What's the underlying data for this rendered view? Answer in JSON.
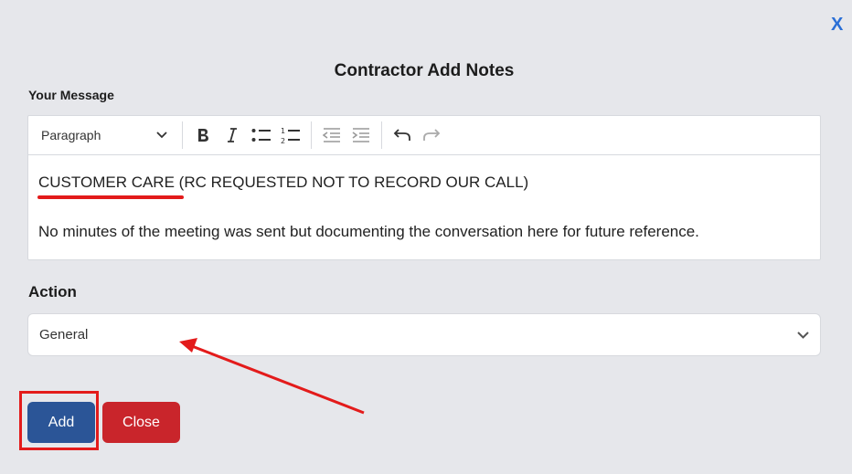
{
  "dialog": {
    "close_glyph": "X",
    "title": "Contractor Add Notes",
    "message_label": "Your Message"
  },
  "editor": {
    "toolbar": {
      "paragraph_format": "Paragraph",
      "buttons": [
        "bold",
        "italic",
        "bulleted-list",
        "numbered-list",
        "outdent",
        "indent",
        "undo",
        "redo"
      ]
    },
    "content": {
      "line1_highlighted": "CUSTOMER CARE",
      "line1_rest": " (RC REQUESTED NOT TO RECORD OUR CALL)",
      "line2": "No minutes of the meeting was sent but documenting the conversation here for future reference."
    }
  },
  "action": {
    "label": "Action",
    "selected": "General"
  },
  "buttons": {
    "add_label": "Add",
    "close_label": "Close"
  },
  "colors": {
    "background": "#e6e7eb",
    "close_x": "#2a6fd6",
    "add_button": "#2b5597",
    "close_button": "#c9252b",
    "annotation": "#e31b1b"
  }
}
